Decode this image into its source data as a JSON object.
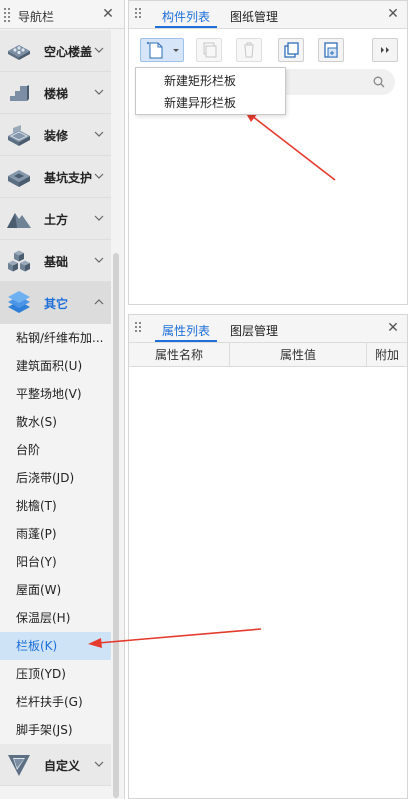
{
  "nav": {
    "title": "导航栏",
    "close_label": "✕",
    "categories": [
      {
        "label": "空心楼盖",
        "icon": "hollow-floor-icon"
      },
      {
        "label": "楼梯",
        "icon": "stairs-icon"
      },
      {
        "label": "装修",
        "icon": "decoration-icon"
      },
      {
        "label": "基坑支护",
        "icon": "pit-support-icon"
      },
      {
        "label": "土方",
        "icon": "earthwork-icon"
      },
      {
        "label": "基础",
        "icon": "foundation-icon"
      },
      {
        "label": "其它",
        "icon": "others-layers-icon"
      },
      {
        "label": "自定义",
        "icon": "custom-icon"
      }
    ],
    "sub_items": [
      {
        "label": "粘钢/纤维布加..."
      },
      {
        "label": "建筑面积(U)"
      },
      {
        "label": "平整场地(V)"
      },
      {
        "label": "散水(S)"
      },
      {
        "label": "台阶"
      },
      {
        "label": "后浇带(JD)"
      },
      {
        "label": "挑檐(T)"
      },
      {
        "label": "雨蓬(P)"
      },
      {
        "label": "阳台(Y)"
      },
      {
        "label": "屋面(W)"
      },
      {
        "label": "保温层(H)"
      },
      {
        "label": "栏板(K)"
      },
      {
        "label": "压顶(YD)"
      },
      {
        "label": "栏杆扶手(G)"
      },
      {
        "label": "脚手架(JS)"
      }
    ]
  },
  "components_panel": {
    "tabs": [
      "构件列表",
      "图纸管理"
    ],
    "close_label": "✕",
    "dropdown": [
      "新建矩形栏板",
      "新建异形栏板"
    ]
  },
  "properties_panel": {
    "tabs": [
      "属性列表",
      "图层管理"
    ],
    "close_label": "✕",
    "columns": [
      "属性名称",
      "属性值",
      "附加"
    ]
  },
  "colors": {
    "accent": "#1e6fd9",
    "selected_bg": "#cfe3f7",
    "arrow": "#e53b2e"
  }
}
